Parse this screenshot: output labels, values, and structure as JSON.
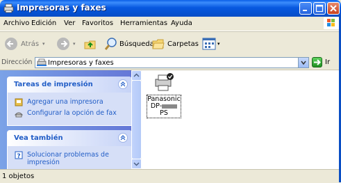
{
  "window": {
    "title": "Impresoras y faxes"
  },
  "menu": [
    "Archivo",
    "Edición",
    "Ver",
    "Favoritos",
    "Herramientas",
    "Ayuda"
  ],
  "toolbar": {
    "back": "Atrás",
    "search": "Búsqueda",
    "folders": "Carpetas"
  },
  "address": {
    "label": "Dirección",
    "value": "Impresoras y faxes",
    "go": "Ir"
  },
  "tasks_panel": {
    "title": "Tareas de impresión",
    "items": [
      "Agregar una impresora",
      "Configurar la opción de fax"
    ]
  },
  "see_also_panel": {
    "title": "Vea también",
    "items": [
      "Solucionar problemas de impresión"
    ]
  },
  "printer": {
    "name_line1": "Panasonic",
    "name_line2_prefix": "DP-",
    "name_line2_suffix": "PS"
  },
  "status": {
    "text": "1 objetos"
  },
  "colors": {
    "title_bar": "#0550D0",
    "task_link": "#215DC6",
    "task_pane_bg": "#6375D6"
  }
}
